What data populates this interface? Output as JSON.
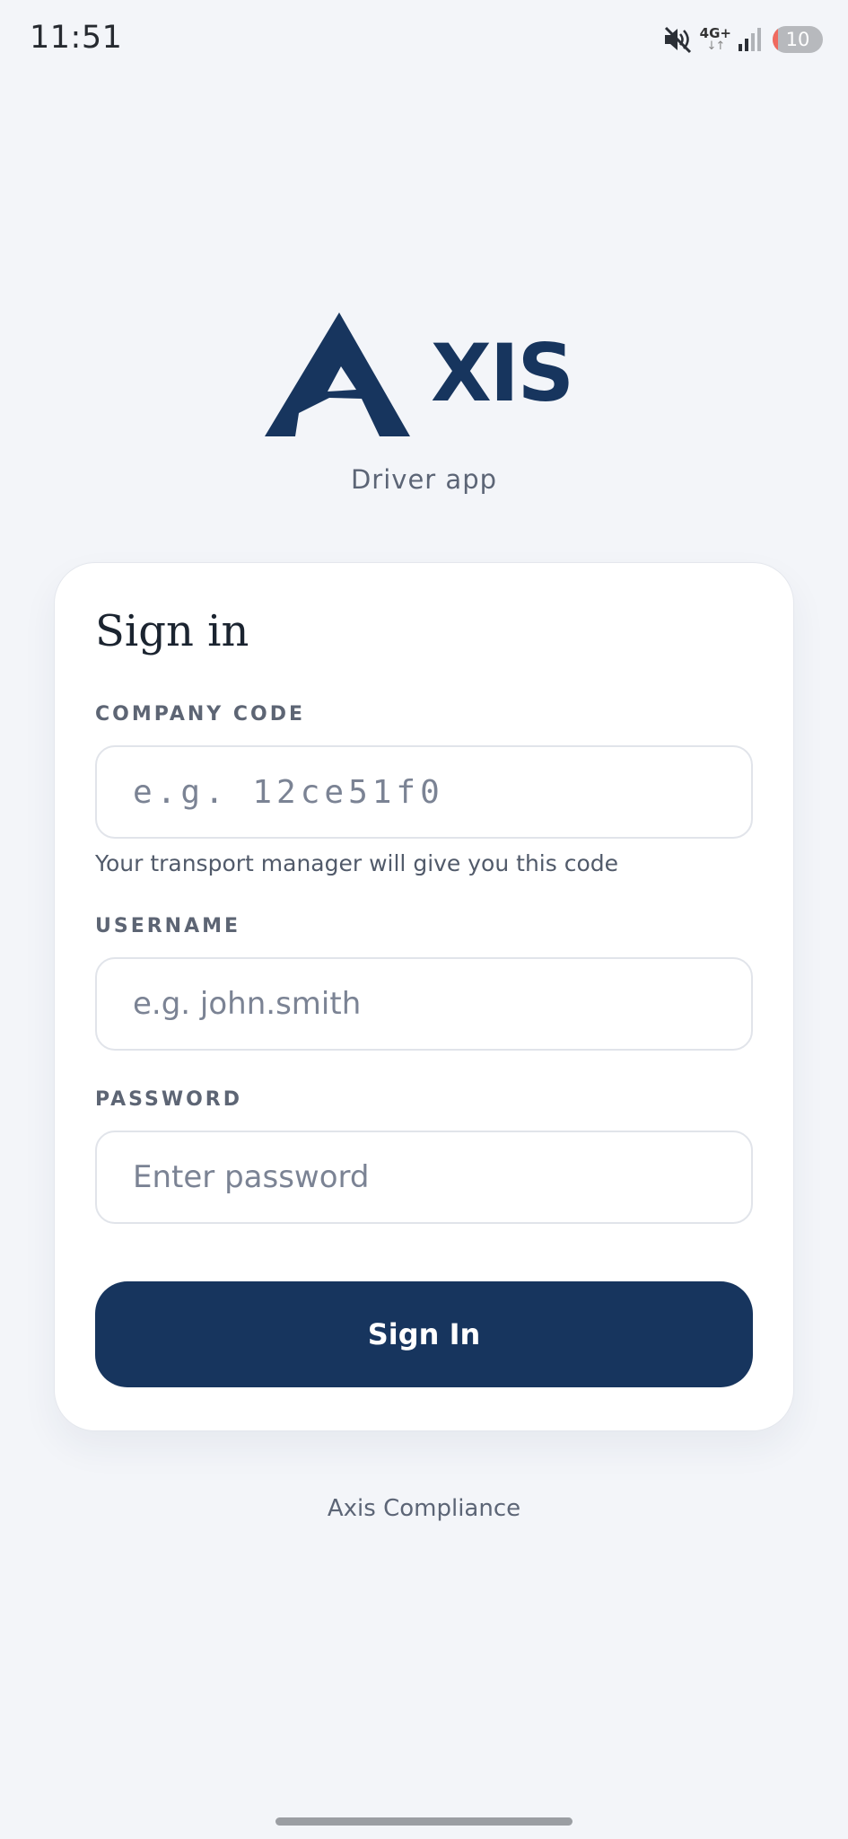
{
  "status_bar": {
    "time": "11:51",
    "network_type": "4G+",
    "network_arrows": "↓↑",
    "battery_level": 10,
    "battery_text": "10",
    "icons": [
      "mute-icon",
      "signal-icon",
      "battery-icon"
    ]
  },
  "branding": {
    "logo_text": "XIS",
    "app_subtitle": "Driver app",
    "brand_color": "#17355e"
  },
  "sign_in": {
    "title": "Sign in",
    "company_code": {
      "label": "COMPANY CODE",
      "placeholder": "e.g. 12ce51f0",
      "value": "",
      "helper": "Your transport manager will give you this code"
    },
    "username": {
      "label": "USERNAME",
      "placeholder": "e.g. john.smith",
      "value": ""
    },
    "password": {
      "label": "PASSWORD",
      "placeholder": "Enter password",
      "value": ""
    },
    "submit_label": "Sign In"
  },
  "footer": {
    "text": "Axis Compliance"
  },
  "colors": {
    "background": "#f3f5f9",
    "card": "#ffffff",
    "button": "#17355e",
    "battery_low": "#f06a5f"
  }
}
